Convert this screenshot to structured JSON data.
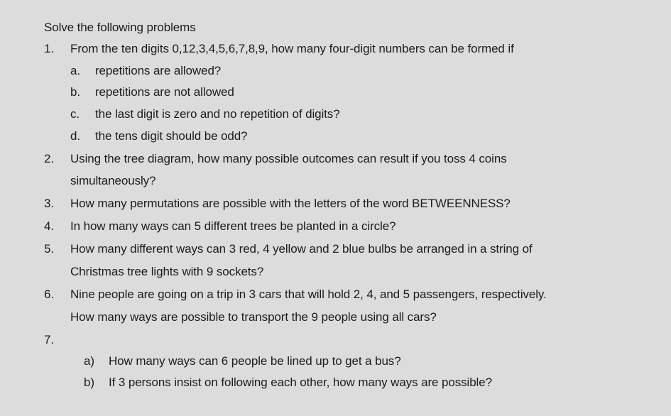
{
  "heading": "Solve the following problems",
  "problems": [
    {
      "number": "1.",
      "text": "From the ten digits 0,12,3,4,5,6,7,8,9, how many four-digit numbers can be formed if",
      "subitems": [
        {
          "marker": "a.",
          "text": "repetitions are allowed?"
        },
        {
          "marker": "b.",
          "text": "repetitions are not allowed"
        },
        {
          "marker": "c.",
          "text": "the last digit is zero and no repetition of digits?"
        },
        {
          "marker": "d.",
          "text": "the tens digit should be odd?"
        }
      ]
    },
    {
      "number": "2.",
      "text": "Using the tree diagram, how many possible outcomes can result if you toss 4 coins",
      "continuation": "simultaneously?"
    },
    {
      "number": "3.",
      "text": "How many permutations are possible with the letters of the word BETWEENNESS?"
    },
    {
      "number": "4.",
      "text": "In how many ways can 5 different trees be planted in a circle?"
    },
    {
      "number": "5.",
      "text": "How many different ways can 3 red, 4 yellow and 2 blue bulbs be arranged in a string of",
      "continuation": "Christmas tree lights with 9  sockets?"
    },
    {
      "number": "6.",
      "text": "Nine people are going on a trip in 3 cars that will hold 2, 4, and 5 passengers, respectively.",
      "continuation": "How many ways are possible to transport the 9 people using all cars?"
    },
    {
      "number": "7.",
      "text": "",
      "subitems": [
        {
          "marker": "a)",
          "text": "How many ways can 6 people be lined up to get a bus?"
        },
        {
          "marker": "b)",
          "text": "If 3 persons insist on following each other, how many ways are possible?"
        }
      ]
    }
  ]
}
